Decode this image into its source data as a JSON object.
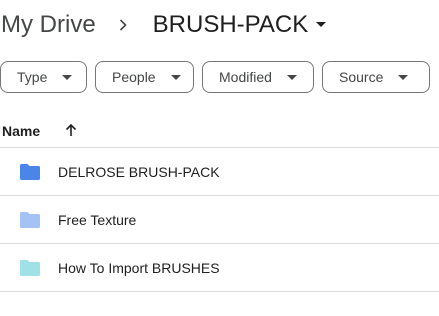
{
  "breadcrumb": {
    "root": "My Drive",
    "current": "BRUSH-PACK"
  },
  "filters": [
    {
      "label": "Type"
    },
    {
      "label": "People"
    },
    {
      "label": "Modified"
    },
    {
      "label": "Source"
    }
  ],
  "table": {
    "header_name": "Name",
    "sort_direction": "ascending"
  },
  "folders": [
    {
      "name": "DELROSE BRUSH-PACK",
      "color": "#4a86e8"
    },
    {
      "name": "Free Texture",
      "color": "#a4c2f4"
    },
    {
      "name": "How To Import BRUSHES",
      "color": "#9fe1e7"
    }
  ]
}
